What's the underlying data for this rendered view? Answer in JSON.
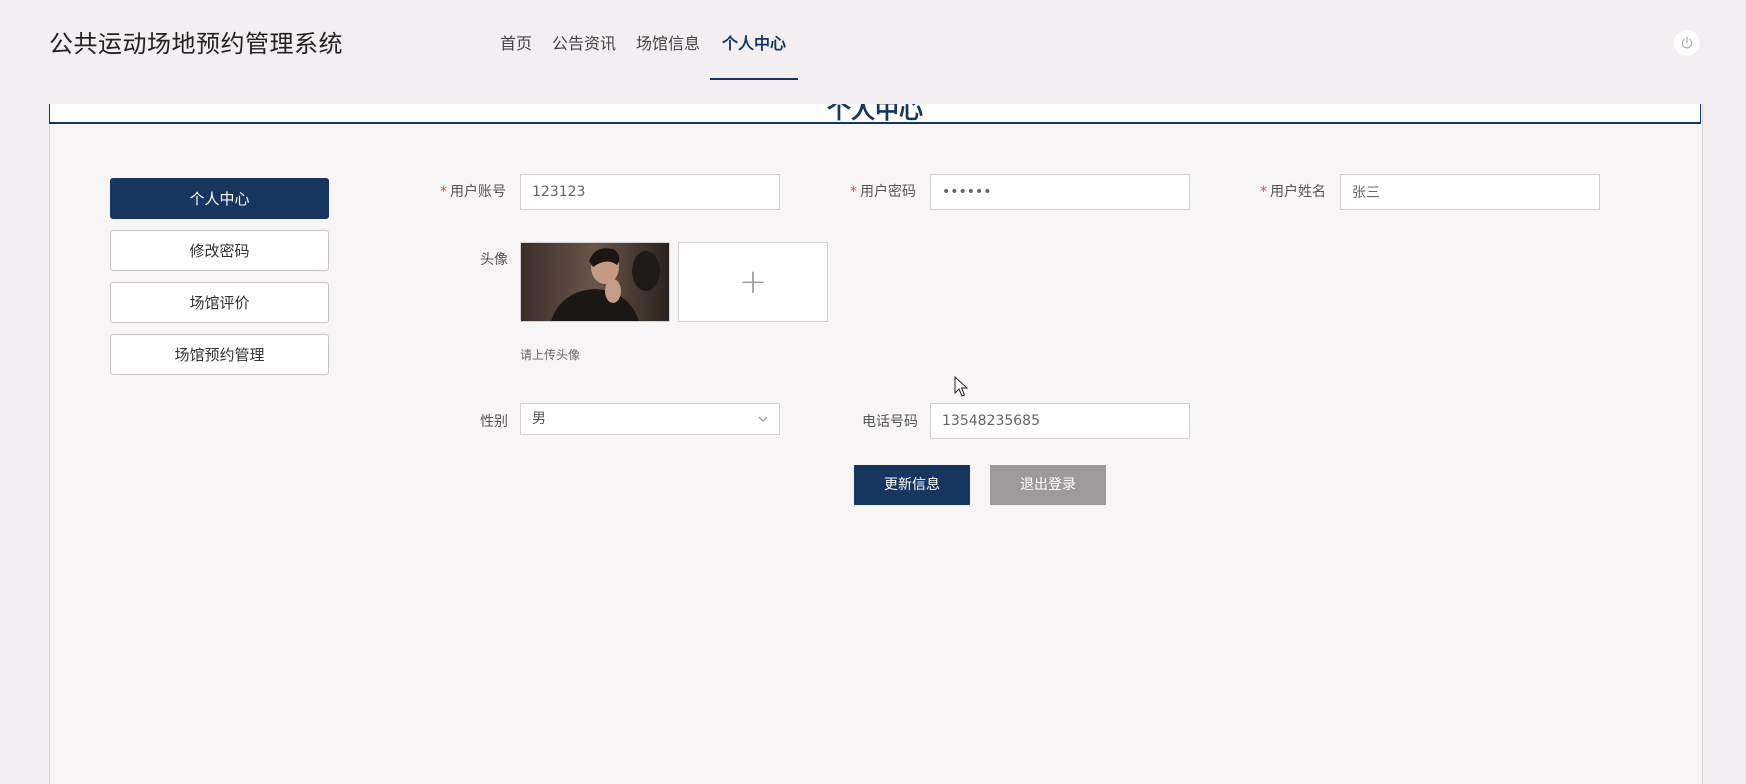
{
  "header": {
    "title": "公共运动场地预约管理系统",
    "nav": [
      {
        "label": "首页",
        "active": false
      },
      {
        "label": "公告资讯",
        "active": false
      },
      {
        "label": "场馆信息",
        "active": false
      },
      {
        "label": "个人中心",
        "active": true
      }
    ],
    "power_icon": "power-icon"
  },
  "card": {
    "banner_title": "个人中心"
  },
  "sidebar": {
    "items": [
      {
        "label": "个人中心",
        "active": true
      },
      {
        "label": "修改密码",
        "active": false
      },
      {
        "label": "场馆评价",
        "active": false
      },
      {
        "label": "场馆预约管理",
        "active": false
      }
    ]
  },
  "form": {
    "account": {
      "label": "用户账号",
      "required": "*",
      "value": "123123"
    },
    "password": {
      "label": "用户密码",
      "required": "*",
      "value": "••••••"
    },
    "name": {
      "label": "用户姓名",
      "required": "*",
      "value": "张三"
    },
    "avatar": {
      "label": "头像",
      "upload_icon": "+",
      "hint": "请上传头像"
    },
    "gender": {
      "label": "性别",
      "value": "男"
    },
    "phone": {
      "label": "电话号码",
      "value": "13548235685"
    }
  },
  "buttons": {
    "update": "更新信息",
    "logout": "退出登录"
  },
  "colors": {
    "primary": "#17365f",
    "secondary": "#9d9a9c",
    "page_bg": "#f2eef1",
    "required": "#e24b4b"
  }
}
